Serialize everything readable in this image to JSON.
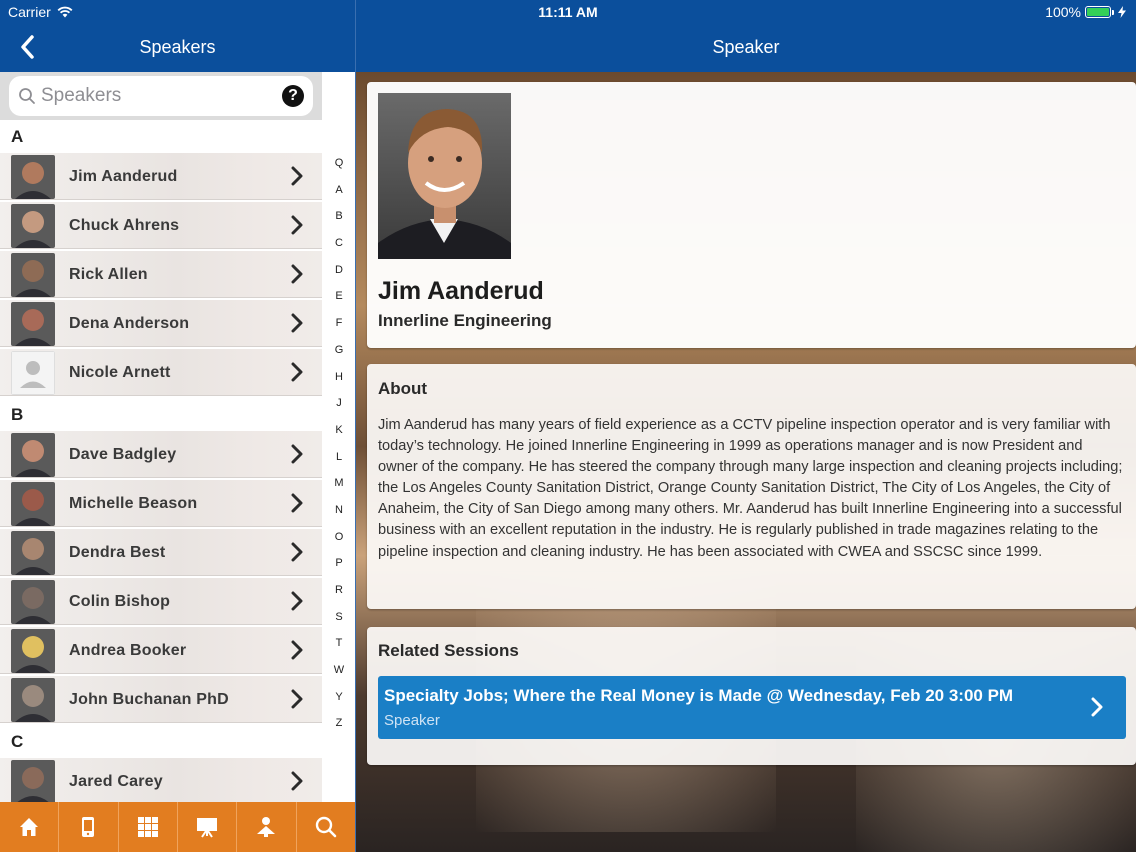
{
  "status_bar": {
    "carrier": "Carrier",
    "time": "11:11 AM",
    "battery": "100%",
    "battery_color": "#34d058"
  },
  "left_nav": {
    "title": "Speakers",
    "back_icon": "chevron-left-icon"
  },
  "right_nav": {
    "title": "Speaker"
  },
  "search": {
    "placeholder": "Speakers",
    "help_label": "?"
  },
  "sections": [
    {
      "letter": "A",
      "speakers": [
        "Jim Aanderud",
        "Chuck Ahrens",
        "Rick Allen",
        "Dena Anderson",
        "Nicole Arnett"
      ]
    },
    {
      "letter": "B",
      "speakers": [
        "Dave Badgley",
        "Michelle Beason",
        "Dendra Best",
        "Colin Bishop",
        "Andrea Booker",
        "John Buchanan PhD"
      ]
    },
    {
      "letter": "C",
      "speakers": [
        "Jared Carey"
      ]
    }
  ],
  "index_letters": [
    "Q",
    "A",
    "B",
    "C",
    "D",
    "E",
    "F",
    "G",
    "H",
    "J",
    "K",
    "L",
    "M",
    "N",
    "O",
    "P",
    "R",
    "S",
    "T",
    "W",
    "Y",
    "Z"
  ],
  "tab_bar": {
    "color": "#e27d20",
    "tabs": [
      "home-icon",
      "mobile-device-icon",
      "grid-icon",
      "presentation-icon",
      "speaker-person-icon",
      "search-icon"
    ]
  },
  "speaker": {
    "name": "Jim Aanderud",
    "company": "Innerline Engineering",
    "about_heading": "About",
    "bio": "Jim Aanderud has many years of field experience as a CCTV pipeline inspection operator and is very familiar with today’s technology. He joined Innerline Engineering in 1999 as operations manager and is now President and owner of the company. He has steered the company through many large inspection and cleaning projects including; the Los Angeles County Sanitation District, Orange County Sanitation District, The City of Los Angeles, the City of Anaheim, the City of San Diego among many others. Mr. Aanderud has built Innerline Engineering into a successful business with an excellent reputation in the industry. He is regularly published in trade magazines relating to the pipeline inspection and cleaning industry. He has been associated with CWEA and SSCSC since 1999.",
    "sessions_heading": "Related Sessions",
    "sessions": [
      {
        "title": "Specialty Jobs; Where the Real Money is Made @ Wednesday, Feb 20 3:00 PM",
        "role": "Speaker"
      }
    ]
  },
  "colors": {
    "nav_blue": "#0b4f9c",
    "session_blue": "#1a7fc6"
  }
}
